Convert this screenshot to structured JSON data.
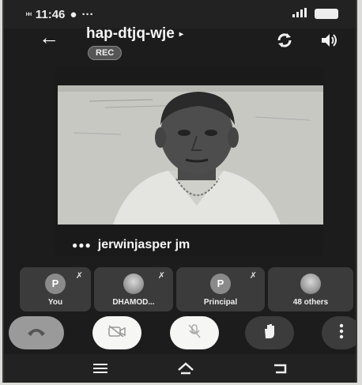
{
  "status_bar": {
    "signal": "ᴴᴴ",
    "time": "11:46",
    "notification": "●",
    "more": "···",
    "battery": ""
  },
  "header": {
    "title": "hap-dtjq-wje",
    "title_chevron": "▸",
    "rec_badge": "REC"
  },
  "main_video": {
    "participant_name": "jerwinjasper jm",
    "audio_indicator": "●●●"
  },
  "participants": [
    {
      "label": "You",
      "avatar": "P",
      "muted": true
    },
    {
      "label": "DHAMOD...",
      "avatar": "",
      "muted": true
    },
    {
      "label": "Principal",
      "avatar": "P",
      "muted": true
    },
    {
      "label": "48 others",
      "avatar": "",
      "muted": false
    }
  ],
  "controls": {
    "end_call": "end-call",
    "video": "video-off",
    "mic": "mic-off",
    "raise_hand": "raise-hand",
    "more": "more-options"
  },
  "colors": {
    "background": "#1c1c1c",
    "tile": "#3b3b3b",
    "control_light": "#f6f6f4",
    "control_dark": "#3c3c3c",
    "end_call": "#9a9a9a"
  }
}
